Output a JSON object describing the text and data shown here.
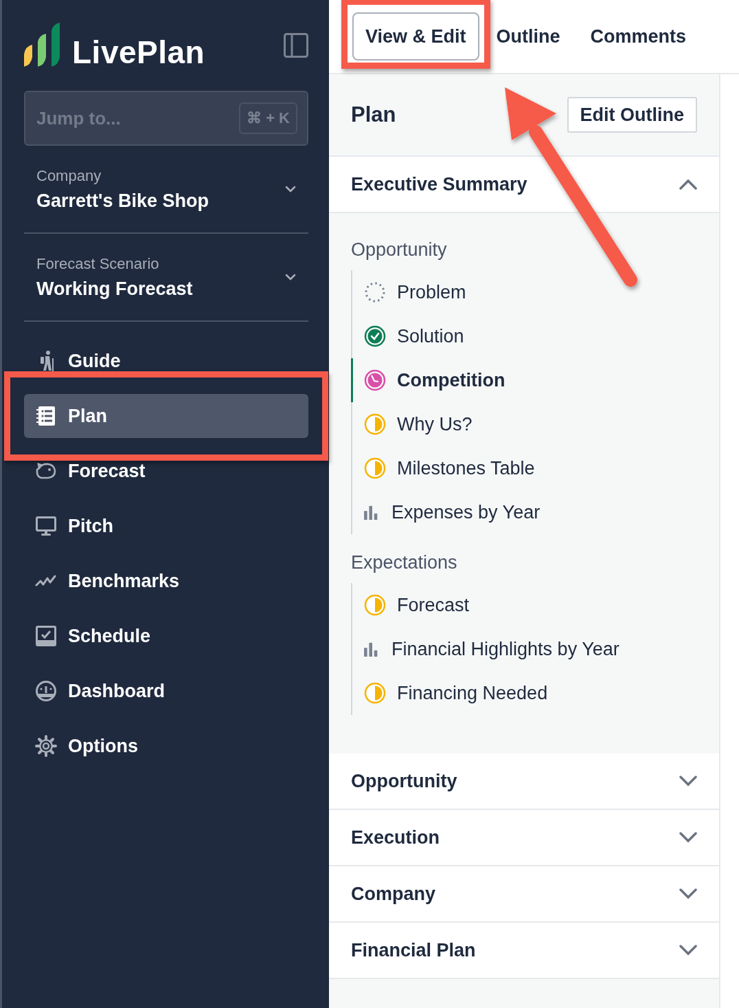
{
  "logo": "LivePlan",
  "sidebar": {
    "search": {
      "placeholder": "Jump to...",
      "shortcut": "⌘ + K"
    },
    "selectors": [
      {
        "label": "Company",
        "value": "Garrett's Bike Shop"
      },
      {
        "label": "Forecast Scenario",
        "value": "Working Forecast"
      }
    ],
    "nav": [
      {
        "label": "Guide",
        "kind": "guide",
        "selected": false,
        "highlighted": false
      },
      {
        "label": "Plan",
        "kind": "plan",
        "selected": true,
        "highlighted": true
      },
      {
        "label": "Forecast",
        "kind": "forecast",
        "selected": false,
        "highlighted": false
      },
      {
        "label": "Pitch",
        "kind": "pitch",
        "selected": false,
        "highlighted": false
      },
      {
        "label": "Benchmarks",
        "kind": "benchmarks",
        "selected": false,
        "highlighted": false
      },
      {
        "label": "Schedule",
        "kind": "schedule",
        "selected": false,
        "highlighted": false
      },
      {
        "label": "Dashboard",
        "kind": "dashboard",
        "selected": false,
        "highlighted": false
      },
      {
        "label": "Options",
        "kind": "options",
        "selected": false,
        "highlighted": false
      }
    ]
  },
  "tabs": [
    {
      "label": "View & Edit",
      "selected": true,
      "highlighted": true
    },
    {
      "label": "Outline",
      "selected": false,
      "highlighted": false
    },
    {
      "label": "Comments",
      "selected": false,
      "highlighted": false
    }
  ],
  "callout_arrow": true,
  "plan": {
    "title": "Plan",
    "button": "Edit Outline",
    "sections": [
      {
        "title": "Executive Summary",
        "expanded": true,
        "groups": [
          {
            "title": "Opportunity",
            "items": [
              {
                "label": "Problem",
                "kind": "empty",
                "selected": false
              },
              {
                "label": "Solution",
                "kind": "done",
                "selected": false
              },
              {
                "label": "Competition",
                "kind": "in_progress",
                "selected": true
              },
              {
                "label": "Why Us?",
                "kind": "partial",
                "selected": false
              },
              {
                "label": "Milestones Table",
                "kind": "partial",
                "selected": false
              },
              {
                "label": "Expenses by Year",
                "kind": "chart",
                "selected": false
              }
            ]
          },
          {
            "title": "Expectations",
            "items": [
              {
                "label": "Forecast",
                "kind": "partial",
                "selected": false
              },
              {
                "label": "Financial Highlights by Year",
                "kind": "chart",
                "selected": false
              },
              {
                "label": "Financing Needed",
                "kind": "partial",
                "selected": false
              }
            ]
          }
        ]
      },
      {
        "title": "Opportunity",
        "expanded": false
      },
      {
        "title": "Execution",
        "expanded": false
      },
      {
        "title": "Company",
        "expanded": false
      },
      {
        "title": "Financial Plan",
        "expanded": false
      }
    ]
  }
}
